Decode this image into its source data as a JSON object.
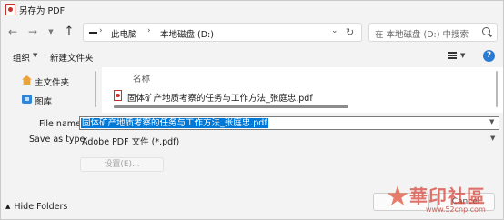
{
  "window": {
    "title": "另存为 PDF"
  },
  "nav": {
    "breadcrumb": [
      "此电脑",
      "本地磁盘 (D:)"
    ],
    "search_placeholder": "在 本地磁盘 (D:) 中搜索"
  },
  "toolbar": {
    "organize": "组织",
    "new_folder": "新建文件夹",
    "help": "?"
  },
  "sidebar": {
    "items": [
      {
        "label": "主文件夹",
        "icon": "home-icon"
      },
      {
        "label": "图库",
        "icon": "gallery-icon"
      }
    ]
  },
  "files": {
    "column_name": "名称",
    "rows": [
      {
        "name": "固体矿产地质考察的任务与工作方法_张庭忠.pdf",
        "icon": "pdf-file-icon"
      }
    ]
  },
  "form": {
    "file_name_label": "File name:",
    "file_name_value": "固体矿产地质考察的任务与工作方法_张庭忠.pdf",
    "save_type_label": "Save as type:",
    "save_type_value": "Adobe PDF 文件 (*.pdf)",
    "settings_button": "设置(E)..."
  },
  "footer": {
    "hide_folders": "Hide Folders",
    "cancel": "Cancel"
  },
  "watermark": {
    "text": "華印社區",
    "url": "www.52cnp.com"
  },
  "colors": {
    "accent": "#0078d7",
    "pdf_red": "#c8302c",
    "help_blue": "#2a7bd3"
  }
}
